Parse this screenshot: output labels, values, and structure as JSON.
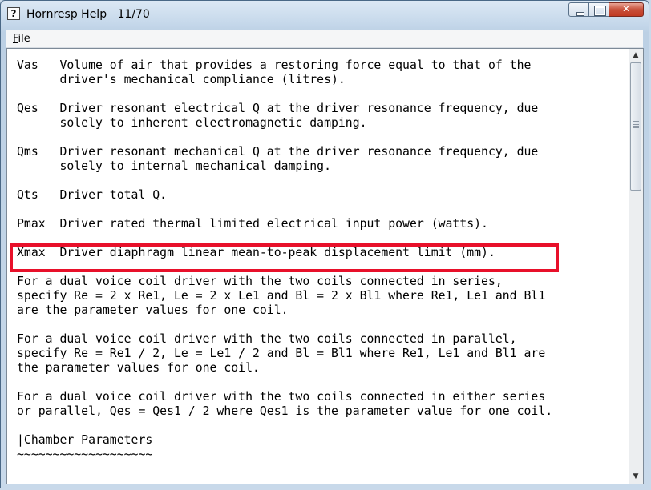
{
  "window": {
    "title": "Hornresp Help",
    "page_indicator": "11/70",
    "app_icon_glyph": "?"
  },
  "menu": {
    "file_mnemonic": "F",
    "file_rest": "ile"
  },
  "help_text": {
    "vas_1": "Vas   Volume of air that provides a restoring force equal to that of the",
    "vas_2": "      driver's mechanical compliance (litres).",
    "qes_1": "Qes   Driver resonant electrical Q at the driver resonance frequency, due",
    "qes_2": "      solely to inherent electromagnetic damping.",
    "qms_1": "Qms   Driver resonant mechanical Q at the driver resonance frequency, due",
    "qms_2": "      solely to internal mechanical damping.",
    "qts_1": "Qts   Driver total Q.",
    "pmax_1": "Pmax  Driver rated thermal limited electrical input power (watts).",
    "xmax_1": "Xmax  Driver diaphragm linear mean-to-peak displacement limit (mm).",
    "series_1": "For a dual voice coil driver with the two coils connected in series,",
    "series_2": "specify Re = 2 x Re1, Le = 2 x Le1 and Bl = 2 x Bl1 where Re1, Le1 and Bl1",
    "series_3": "are the parameter values for one coil.",
    "parallel_1": "For a dual voice coil driver with the two coils connected in parallel,",
    "parallel_2": "specify Re = Re1 / 2, Le = Le1 / 2 and Bl = Bl1 where Re1, Le1 and Bl1 are",
    "parallel_3": "the parameter values for one coil.",
    "either_1": "For a dual voice coil driver with the two coils connected in either series",
    "either_2": "or parallel, Qes = Qes1 / 2 where Qes1 is the parameter value for one coil.",
    "chamber_1": "|Chamber Parameters",
    "chamber_2": "~~~~~~~~~~~~~~~~~~~"
  },
  "colors": {
    "highlight_border": "#e8102a"
  }
}
